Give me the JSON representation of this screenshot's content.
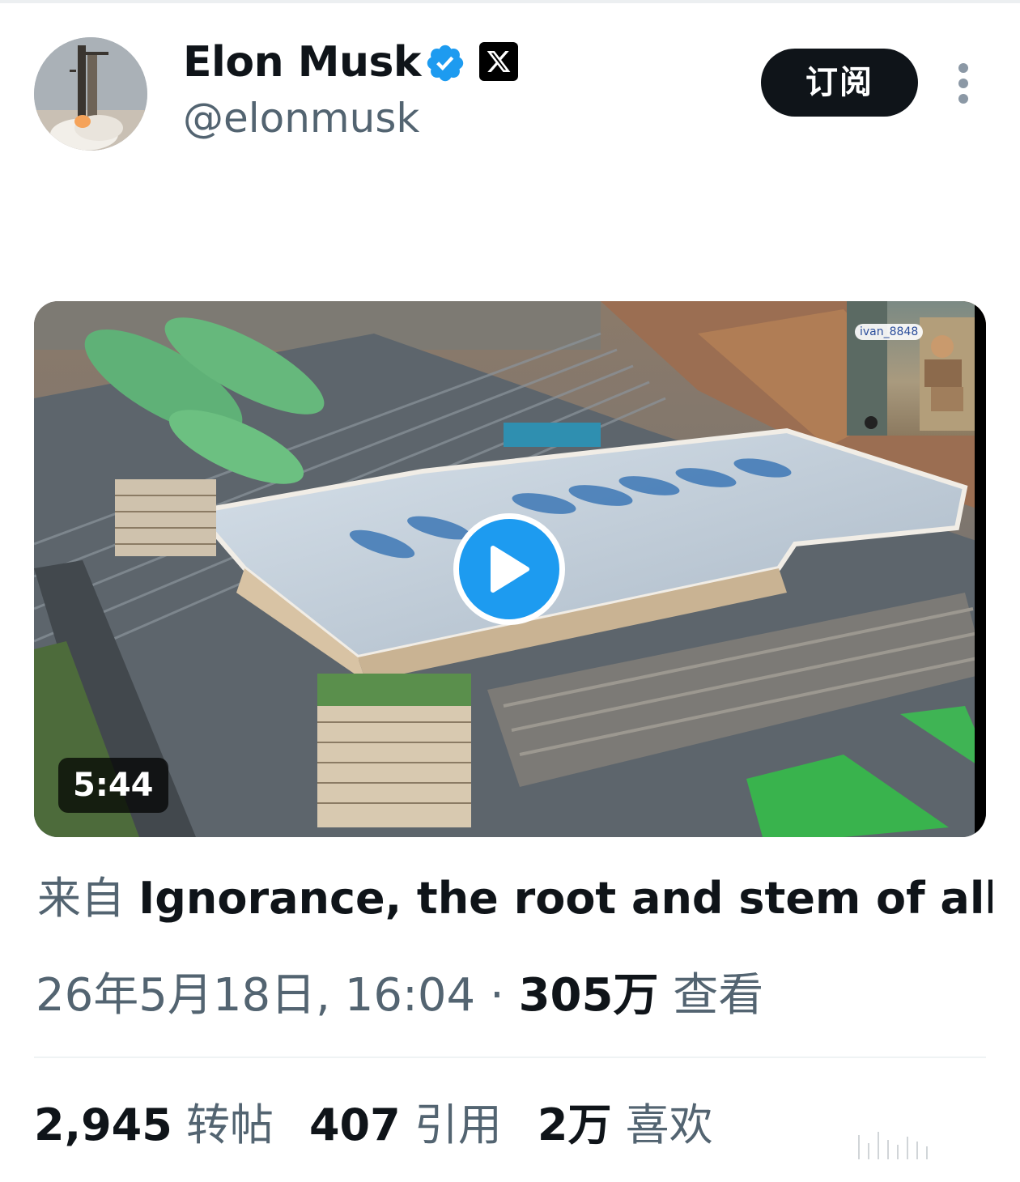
{
  "author": {
    "name": "Elon Musk",
    "handle": "@elonmusk"
  },
  "header": {
    "subscribe_label": "订阅"
  },
  "media": {
    "inset_label": "ivan_8848",
    "duration": "5:44"
  },
  "caption": {
    "prefix": "来自",
    "title": "Ignorance, the root and stem of all ..."
  },
  "meta": {
    "date_time": "26年5月18日, 16:04",
    "separator": "·",
    "views_count": "305万",
    "views_label": "查看"
  },
  "stats": {
    "reposts_count": "2,945",
    "reposts_label": "转帖",
    "quotes_count": "407",
    "quotes_label": "引用",
    "likes_count": "2万",
    "likes_label": "喜欢"
  },
  "colors": {
    "accent": "#1d9bf0",
    "text_primary": "#0f1419",
    "text_secondary": "#536471",
    "button_bg": "#0f1419"
  }
}
